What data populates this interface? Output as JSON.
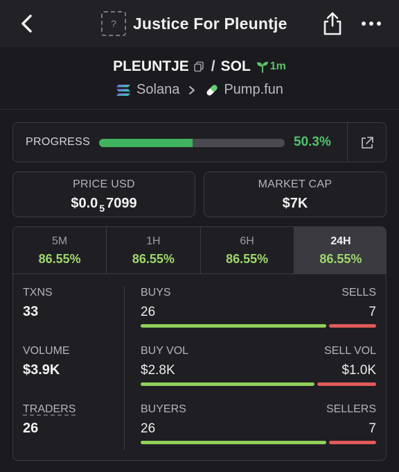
{
  "header": {
    "title": "Justice For Pleuntje",
    "token_placeholder": "?"
  },
  "pair": {
    "base": "PLEUNTJE",
    "separator": "/",
    "quote": "SOL",
    "age": "1m",
    "chain": "Solana",
    "dex": "Pump.fun"
  },
  "progress": {
    "label": "PROGRESS",
    "value_text": "50.3%",
    "fraction": 0.503
  },
  "price": {
    "label": "PRICE USD",
    "prefix": "$0.0",
    "zeros": "5",
    "digits": "7099"
  },
  "market_cap": {
    "label": "MARKET CAP",
    "value": "$7K"
  },
  "tabs": [
    {
      "label": "5M",
      "value": "86.55%"
    },
    {
      "label": "1H",
      "value": "86.55%"
    },
    {
      "label": "6H",
      "value": "86.55%"
    },
    {
      "label": "24H",
      "value": "86.55%"
    }
  ],
  "metrics": {
    "txns": {
      "label": "TXNS",
      "value": "33"
    },
    "volume": {
      "label": "VOLUME",
      "value": "$3.9K"
    },
    "traders": {
      "label": "TRADERS",
      "value": "26"
    }
  },
  "splits": {
    "txns": {
      "left_label": "BUYS",
      "right_label": "SELLS",
      "left_value": "26",
      "right_value": "7",
      "left_fraction": 0.788
    },
    "volume": {
      "left_label": "BUY VOL",
      "right_label": "SELL VOL",
      "left_value": "$2.8K",
      "right_value": "$1.0K",
      "left_fraction": 0.737
    },
    "traders": {
      "left_label": "BUYERS",
      "right_label": "SELLERS",
      "left_value": "26",
      "right_value": "7",
      "left_fraction": 0.788
    }
  },
  "colors": {
    "accent_green": "#4fc36c",
    "buy_green": "#8fd05a",
    "sell_red": "#e25a5a",
    "change_green": "#9fd86a"
  }
}
